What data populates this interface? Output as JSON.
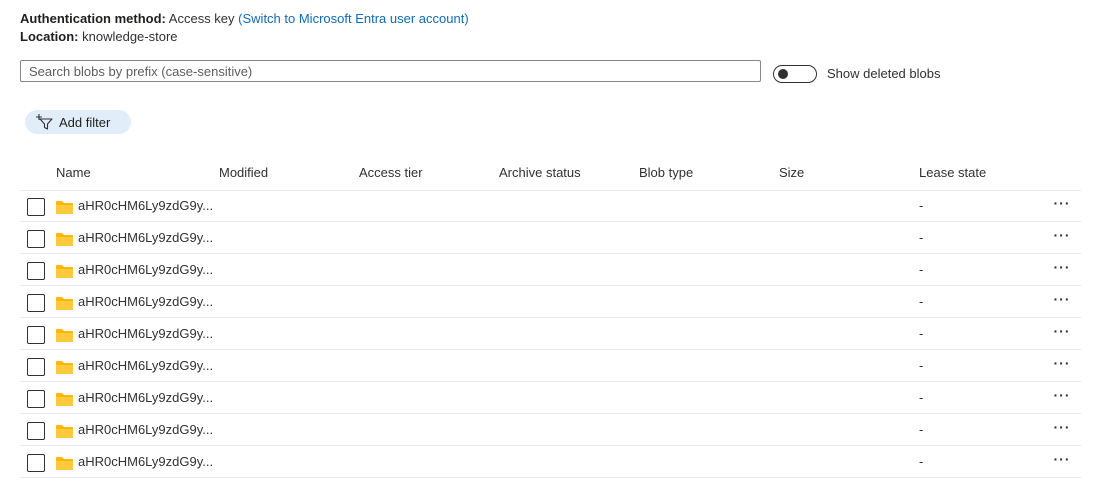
{
  "auth": {
    "label": "Authentication method:",
    "value": "Access key",
    "link": "(Switch to Microsoft Entra user account)"
  },
  "location": {
    "label": "Location:",
    "value": "knowledge-store"
  },
  "search": {
    "placeholder": "Search blobs by prefix (case-sensitive)"
  },
  "deleted_toggle": {
    "label": "Show deleted blobs",
    "on": false
  },
  "filter": {
    "label": "Add filter"
  },
  "table": {
    "headers": [
      "Name",
      "Modified",
      "Access tier",
      "Archive status",
      "Blob type",
      "Size",
      "Lease state"
    ],
    "rows": [
      {
        "name": "aHR0cHM6Ly9zdG9y...",
        "lease_state": "-"
      },
      {
        "name": "aHR0cHM6Ly9zdG9y...",
        "lease_state": "-"
      },
      {
        "name": "aHR0cHM6Ly9zdG9y...",
        "lease_state": "-"
      },
      {
        "name": "aHR0cHM6Ly9zdG9y...",
        "lease_state": "-"
      },
      {
        "name": "aHR0cHM6Ly9zdG9y...",
        "lease_state": "-"
      },
      {
        "name": "aHR0cHM6Ly9zdG9y...",
        "lease_state": "-"
      },
      {
        "name": "aHR0cHM6Ly9zdG9y...",
        "lease_state": "-"
      },
      {
        "name": "aHR0cHM6Ly9zdG9y...",
        "lease_state": "-"
      },
      {
        "name": "aHR0cHM6Ly9zdG9y...",
        "lease_state": "-"
      }
    ],
    "more_label": "···"
  },
  "colors": {
    "link": "#0f6cbd",
    "filter_bg": "#e1eefa",
    "folder": "#ffb900"
  }
}
